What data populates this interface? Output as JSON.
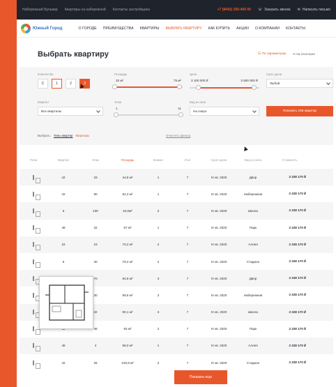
{
  "topbar": {
    "links": [
      "Набережный Бульвар",
      "Квартиры на набережной",
      "Контакты застройщика"
    ],
    "phone": "+7 (8442) 250-400 00",
    "callback": "Заказать звонок",
    "message": "Написать письмо"
  },
  "nav": {
    "logo": "Южный Город",
    "items": [
      "О ГОРОДЕ",
      "ПРЕИМУЩЕСТВА",
      "КВАРТИРЫ",
      "ВЫБРАТЬ КВАРТИРУ",
      "КАК КУПИТЬ",
      "АКЦИИ",
      "О КОМПАНИИ",
      "КОНТАКТЫ"
    ]
  },
  "page": {
    "title": "Выбрать квартиру",
    "view_params": "По параметрам",
    "view_plan": "На генплане"
  },
  "filters": {
    "rooms_label": "Количество",
    "rooms": [
      "С",
      "1",
      "2",
      "3"
    ],
    "area_label": "Площадь",
    "area_min": "32 м²",
    "area_max": "75 м²",
    "area_fill": [
      0.0,
      0.95
    ],
    "price_label": "Цена",
    "price_min": "3 100 000 ₽",
    "price_max": "3 500 000 ₽",
    "price_fill": [
      0.12,
      0.92
    ],
    "deadline_label": "Срок сдачи",
    "deadline_value": "Любой",
    "quarter_label": "Квартал",
    "quarter_value": "Все кварталы",
    "floor_label": "Этаж",
    "floor_min": "1",
    "floor_max": "11",
    "view_label": "Вид из окна",
    "view_value": "На озеро",
    "show_button": "Показать 156 квартир",
    "chosen_label": "Выбрать:",
    "chosen_chip1": "Типы квартир",
    "chosen_chip2": "Квартиры",
    "reset": "Очистить фильтр"
  },
  "table": {
    "columns": [
      "План",
      "Квартал",
      "Этаж",
      "Площадь",
      "Комнат",
      "Угол",
      "Срок сдачи",
      "Вид из окна",
      "Стоимость"
    ],
    "rows": [
      [
        "42",
        "33",
        "44,8 м²",
        "1",
        "7",
        "IV кв. 2020",
        "Двор",
        "3 228 170 ₽"
      ],
      [
        "42",
        "90",
        "52,3 м²",
        "1",
        "7",
        "IV кв. 2020",
        "Набережная",
        "3 228 170 ₽"
      ],
      [
        "6",
        "230",
        "34,0м²",
        "2",
        "7",
        "IV кв. 2020",
        "Школа",
        "3 228 170 ₽"
      ],
      [
        "48",
        "32",
        "67 м²",
        "1",
        "7",
        "IV кв. 2020",
        "Парк",
        "3 228 170 ₽"
      ],
      [
        "22",
        "23",
        "70,2 м²",
        "2",
        "7",
        "IV кв. 2020",
        "Аллея",
        "3 228 170 ₽"
      ],
      [
        "6",
        "30",
        "79,4 м²",
        "2",
        "7",
        "IV кв. 2020",
        "Стадион",
        "3 228 170 ₽"
      ],
      [
        "48",
        "70",
        "84,6 м²",
        "3",
        "7",
        "IV кв. 2020",
        "Двор",
        "3 228 170 ₽"
      ],
      [
        "6",
        "30",
        "89,6 м²",
        "3",
        "7",
        "IV кв. 2020",
        "Набережная",
        "3 228 170 ₽"
      ],
      [
        "4",
        "32",
        "90,1 м²",
        "3",
        "7",
        "IV кв. 2020",
        "Школа",
        "3 228 170 ₽"
      ],
      [
        "42",
        "48",
        "93 м²",
        "2",
        "7",
        "IV кв. 2020",
        "Парк",
        "3 228 170 ₽"
      ],
      [
        "48",
        "4",
        "98,0 м²",
        "1",
        "7",
        "IV кв. 2020",
        "Аллея",
        "3 228 170 ₽"
      ],
      [
        "42",
        "25",
        "103,9 м²",
        "2",
        "7",
        "IV кв. 2020",
        "Стадион",
        "3 228 170 ₽"
      ]
    ],
    "more_button": "Показать еще"
  }
}
